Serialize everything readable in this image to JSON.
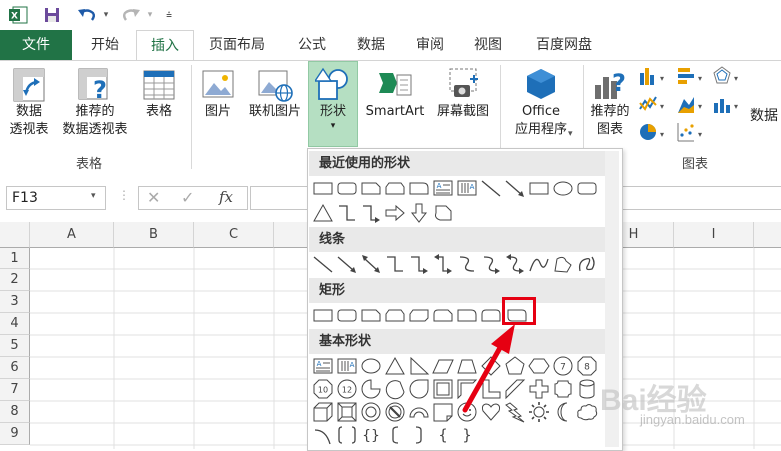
{
  "tabs": {
    "file": "文件",
    "home": "开始",
    "insert": "插入",
    "page_layout": "页面布局",
    "formulas": "公式",
    "data": "数据",
    "review": "审阅",
    "view": "视图",
    "baidu_pan": "百度网盘"
  },
  "ribbon": {
    "pivot_table": [
      "数据",
      "透视表"
    ],
    "recommended_pivot": [
      "推荐的",
      "数据透视表"
    ],
    "table": "表格",
    "tables_group": "表格",
    "picture": "图片",
    "online_picture": "联机图片",
    "shapes": "形状",
    "smartart": "SmartArt",
    "screenshot": "屏幕截图",
    "office_apps": [
      "Office",
      "应用程序"
    ],
    "recommended_charts": [
      "推荐的",
      "图表"
    ],
    "charts_group": "图表",
    "partial_label": "数据"
  },
  "formula_bar": {
    "name_box": "F13",
    "fx": "fx"
  },
  "grid": {
    "columns": [
      "A",
      "B",
      "C",
      "H",
      "I"
    ],
    "rows": [
      "1",
      "2",
      "3",
      "4",
      "5",
      "6",
      "7",
      "8",
      "9"
    ]
  },
  "shapes_menu": {
    "recent": "最近使用的形状",
    "lines": "线条",
    "rectangles": "矩形",
    "basic": "基本形状",
    "shape_text_7": "7",
    "shape_text_8": "8",
    "shape_text_10": "10",
    "shape_text_12": "12"
  },
  "watermark": {
    "brand": "Bai经验",
    "url": "jingyan.baidu.com"
  },
  "colors": {
    "excel_green": "#217346",
    "highlight_red": "#e60012",
    "shape_hover": "#b5dfc2"
  }
}
